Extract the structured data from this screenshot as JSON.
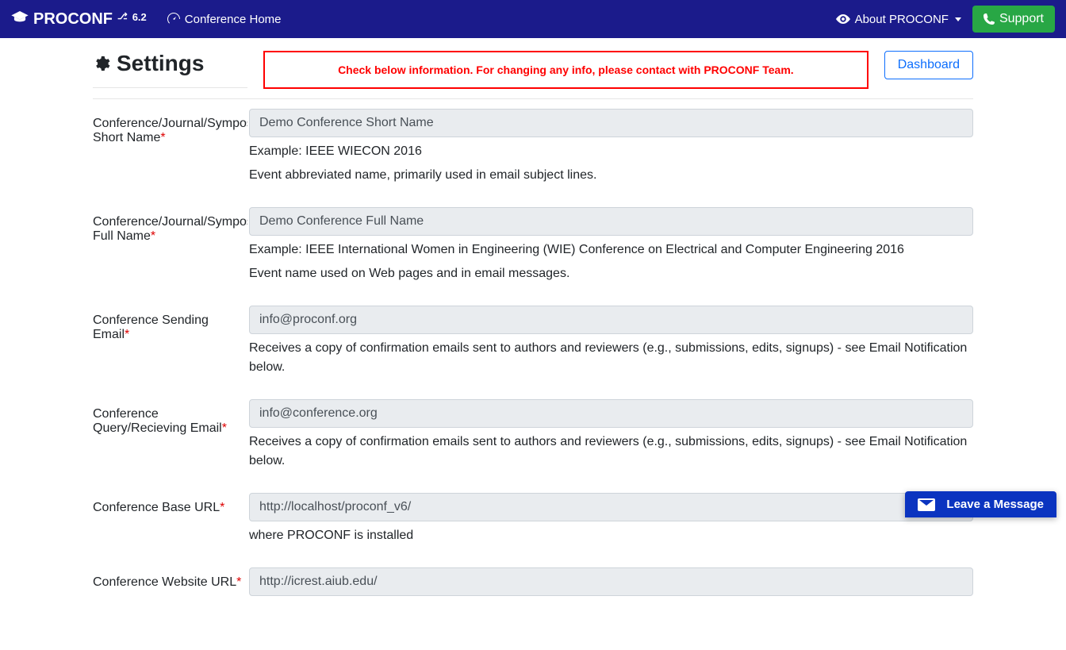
{
  "navbar": {
    "brand": "PROCONF",
    "version": "6.2",
    "home_link": "Conference Home",
    "about_link": "About PROCONF",
    "support_btn": "Support"
  },
  "page": {
    "title": "Settings",
    "alert": "Check below information. For changing any info, please contact with PROCONF Team.",
    "dashboard_btn": "Dashboard"
  },
  "fields": {
    "short_name": {
      "label": "Conference/Journal/Symposium/Seminar Short Name",
      "value": "Demo Conference Short Name",
      "help1": "Example: IEEE WIECON 2016",
      "help2": "Event abbreviated name, primarily used in email subject lines."
    },
    "full_name": {
      "label": "Conference/Journal/Symposium/Seminar Full Name",
      "value": "Demo Conference Full Name",
      "help1": "Example: IEEE International Women in Engineering (WIE) Conference on Electrical and Computer Engineering 2016",
      "help2": "Event name used on Web pages and in email messages."
    },
    "sending_email": {
      "label": "Conference Sending Email",
      "value": "info@proconf.org",
      "help": "Receives a copy of confirmation emails sent to authors and reviewers (e.g., submissions, edits, signups) - see Email Notification below."
    },
    "query_email": {
      "label": "Conference Query/Recieving Email",
      "value": "info@conference.org",
      "help": "Receives a copy of confirmation emails sent to authors and reviewers (e.g., submissions, edits, signups) - see Email Notification below."
    },
    "base_url": {
      "label": "Conference Base URL",
      "value": "http://localhost/proconf_v6/",
      "help": "where PROCONF is installed"
    },
    "website_url": {
      "label": "Conference Website URL",
      "value": "http://icrest.aiub.edu/"
    }
  },
  "chat": {
    "label": "Leave a Message"
  }
}
